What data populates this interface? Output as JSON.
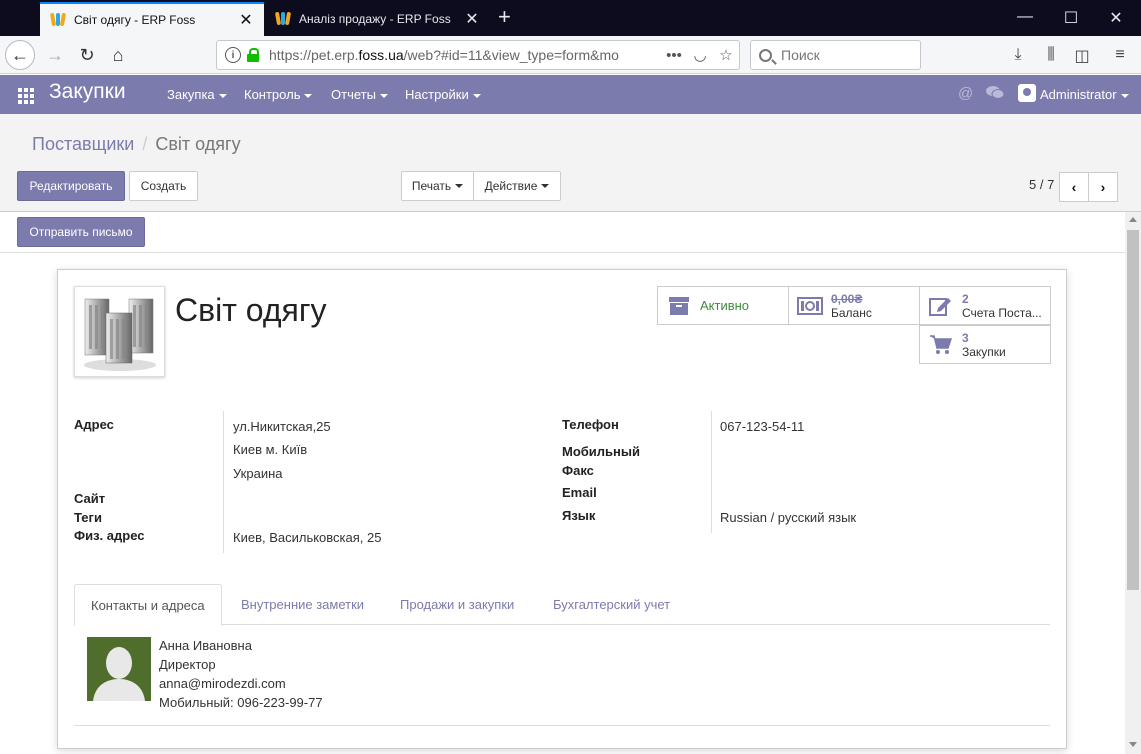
{
  "browser": {
    "tabs": [
      {
        "title": "Світ одягу - ERP Foss",
        "active": true
      },
      {
        "title": "Аналіз продажу - ERP Foss",
        "active": false
      }
    ],
    "url_prefix": "https://pet.erp.",
    "url_domain": "foss.ua",
    "url_suffix": "/web?#id=11&view_type=form&mo",
    "search_placeholder": "Поиск"
  },
  "app": {
    "name": "Закупки",
    "menus": [
      "Закупка",
      "Контроль",
      "Отчеты",
      "Настройки"
    ],
    "user": "Administrator",
    "accent": "#7c7bad"
  },
  "control_panel": {
    "breadcrumb_parent": "Поставщики",
    "breadcrumb_current": "Світ одягу",
    "edit_label": "Редактировать",
    "create_label": "Создать",
    "print_label": "Печать",
    "action_label": "Действие",
    "pager": "5 / 7"
  },
  "statusbar": {
    "send_mail_label": "Отправить письмо"
  },
  "partner": {
    "name": "Світ одягу",
    "smart_buttons": {
      "active": "Активно",
      "balance_value": "0,00₴",
      "balance_label": "Баланс",
      "bills_value": "2",
      "bills_label": "Счета Поста...",
      "purchases_value": "3",
      "purchases_label": "Закупки"
    },
    "fields_left": {
      "address_label": "Адрес",
      "street": "ул.Никитская,25",
      "city": "Киев  м. Київ",
      "country": "Украина",
      "site_label": "Сайт",
      "tags_label": "Теги",
      "phys_address_label": "Физ. адрес",
      "phys_address": "Киев, Васильковская, 25"
    },
    "fields_right": {
      "phone_label": "Телефон",
      "phone": "067-123-54-11",
      "mobile_label": "Мобильный",
      "fax_label": "Факс",
      "email_label": "Email",
      "lang_label": "Язык",
      "lang": "Russian / русский язык"
    }
  },
  "notebook": {
    "tabs": [
      "Контакты и адреса",
      "Внутренние заметки",
      "Продажи и закупки",
      "Бухгалтерский учет"
    ]
  },
  "contact": {
    "name": "Анна Ивановна",
    "function": "Директор",
    "email": "anna@mirodezdi.com",
    "mobile": "Мобильный: 096-223-99-77"
  }
}
